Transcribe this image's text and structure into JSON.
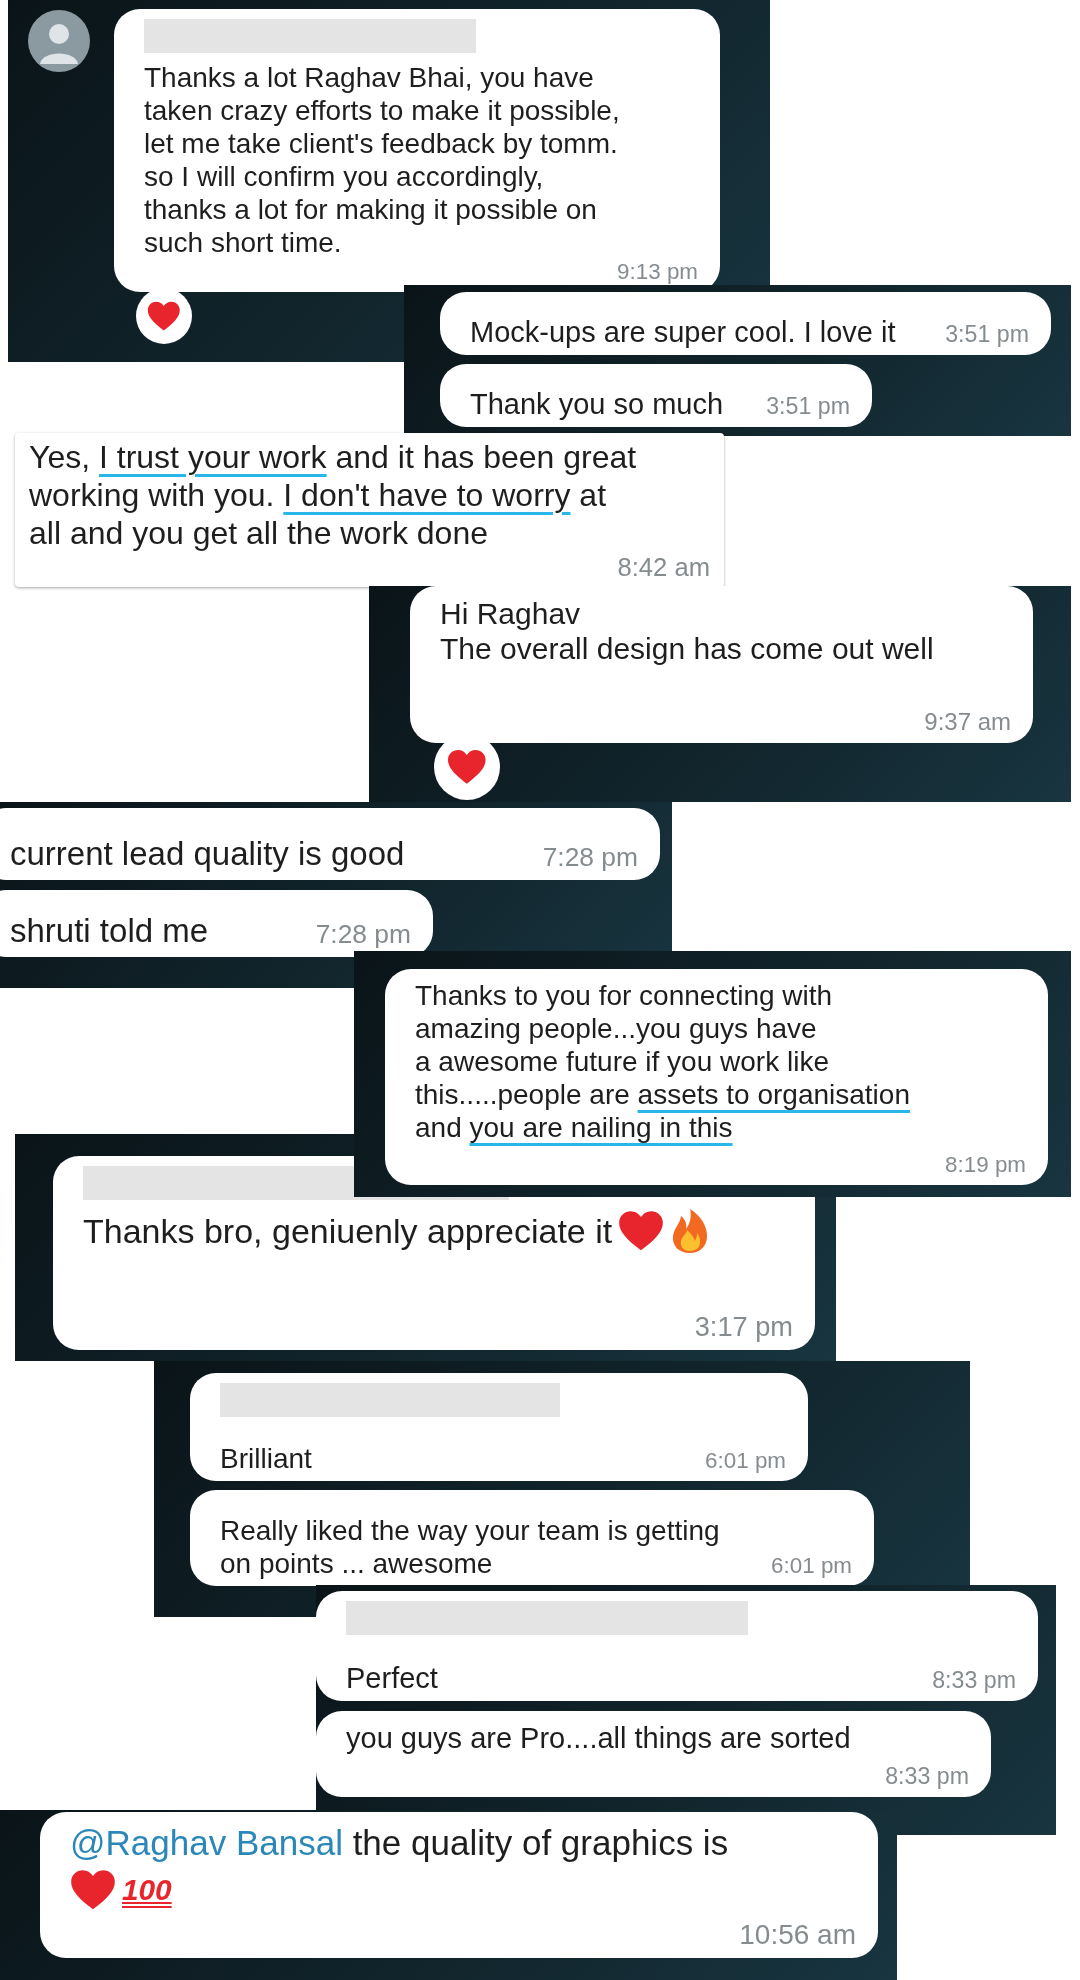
{
  "clips": [
    {
      "kind": "dark",
      "avatar": true,
      "messages": [
        {
          "sender_hidden": true,
          "lines": [
            "Thanks a lot Raghav Bhai, you have",
            "taken crazy efforts to make it possible,",
            "let me take client's feedback by tomm.",
            "so I will confirm you accordingly,",
            "thanks a lot for making it possible on",
            "such short time."
          ],
          "time": "9:13 pm",
          "reaction": {
            "kind": "heart"
          }
        }
      ]
    },
    {
      "kind": "dark",
      "messages": [
        {
          "lines": [
            "Mock-ups are super cool. I love it"
          ],
          "time": "3:51 pm"
        },
        {
          "lines": [
            "Thank you so much"
          ],
          "time": "3:51 pm"
        }
      ]
    },
    {
      "kind": "plain",
      "messages": [
        {
          "lines": [
            [
              {
                "text": "Yes, ",
                "kind": "plain"
              },
              {
                "text": "I trust your work",
                "kind": "underline"
              },
              {
                "text": " and it has been great",
                "kind": "plain"
              }
            ],
            [
              {
                "text": "working with you. ",
                "kind": "plain"
              },
              {
                "text": "I don't have to worry",
                "kind": "underline"
              },
              {
                "text": " at",
                "kind": "plain"
              }
            ],
            "all and you get all the work done"
          ],
          "time": "8:42 am"
        }
      ]
    },
    {
      "kind": "dark",
      "messages": [
        {
          "lines": [
            "Hi Raghav",
            "The overall design has come out well"
          ],
          "time": "9:37 am",
          "reaction": {
            "kind": "heart"
          }
        }
      ]
    },
    {
      "kind": "dark",
      "messages": [
        {
          "lines": [
            "current lead quality is good"
          ],
          "time": "7:28 pm"
        },
        {
          "lines": [
            "shruti told me"
          ],
          "time": "7:28 pm"
        }
      ]
    },
    {
      "kind": "dark",
      "messages": [
        {
          "lines": [
            "Thanks to you for connecting with",
            "amazing people...you guys have",
            "a awesome future if you work like",
            [
              {
                "text": "this.....people are ",
                "kind": "plain"
              },
              {
                "text": "assets to organisation",
                "kind": "underline"
              }
            ],
            [
              {
                "text": "and ",
                "kind": "plain"
              },
              {
                "text": "you are nailing in this",
                "kind": "underline"
              }
            ]
          ],
          "time": "8:19 pm"
        }
      ]
    },
    {
      "kind": "dark",
      "messages": [
        {
          "sender_hidden": true,
          "lines": [
            "Thanks bro, geniuenly appreciate it"
          ],
          "emojis": [
            {
              "kind": "heart"
            },
            {
              "kind": "fire"
            }
          ],
          "time": "3:17 pm"
        }
      ]
    },
    {
      "kind": "dark",
      "messages": [
        {
          "sender_hidden": true,
          "lines": [
            "Brilliant"
          ],
          "time": "6:01 pm"
        },
        {
          "lines": [
            "Really liked the way your team is getting",
            "on points ... awesome"
          ],
          "time": "6:01 pm"
        }
      ]
    },
    {
      "kind": "dark",
      "messages": [
        {
          "sender_hidden": true,
          "lines": [
            "Perfect"
          ],
          "time": "8:33 pm"
        },
        {
          "lines": [
            "you guys are Pro....all things are sorted"
          ],
          "time": "8:33 pm"
        }
      ]
    },
    {
      "kind": "dark",
      "messages": [
        {
          "lines": [
            [
              {
                "text": "@Raghav Bansal",
                "kind": "mention"
              },
              {
                "text": " the quality of graphics is",
                "kind": "plain"
              }
            ]
          ],
          "emojis": [
            {
              "kind": "heart"
            },
            {
              "kind": "hundred",
              "text": "100"
            }
          ],
          "time": "10:56 am"
        }
      ]
    }
  ]
}
